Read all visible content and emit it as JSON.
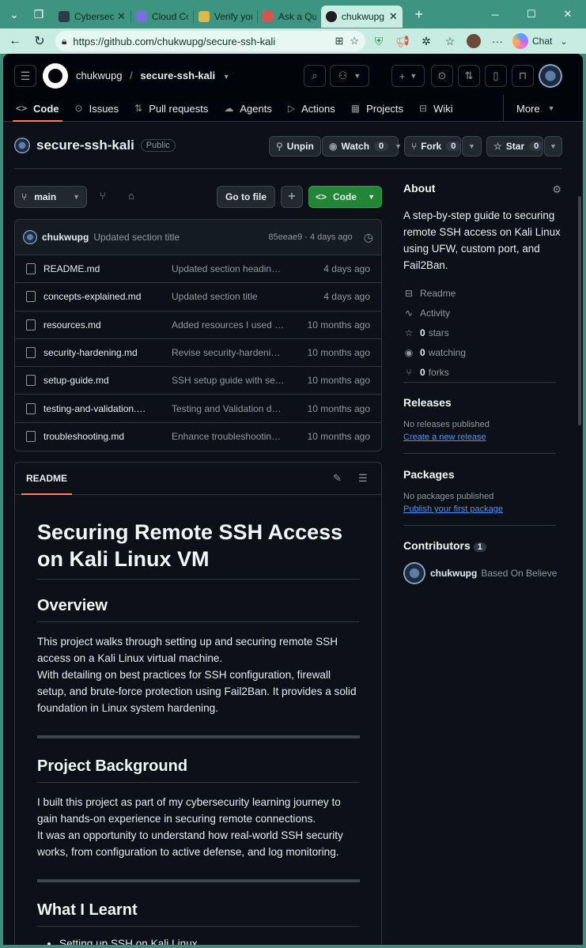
{
  "browser": {
    "tabs": [
      {
        "title": "Cybersecu",
        "favicon": "#2d3a48"
      },
      {
        "title": "Cloud Cor",
        "favicon": "#7d6ee0"
      },
      {
        "title": "Verify you",
        "favicon": "#e0b84a"
      },
      {
        "title": "Ask a Que",
        "favicon": "#d9534f"
      },
      {
        "title": "chukwupg",
        "favicon": "#1b1f24"
      }
    ],
    "url": "https://github.com/chukwupg/secure-ssh-kali",
    "chat_label": "Chat"
  },
  "header": {
    "owner": "chukwupg",
    "repo": "secure-ssh-kali"
  },
  "repo_nav": [
    {
      "label": "Code",
      "icon": "code-icon"
    },
    {
      "label": "Issues",
      "icon": "issue-icon"
    },
    {
      "label": "Pull requests",
      "icon": "pull-request-icon"
    },
    {
      "label": "Agents",
      "icon": "agents-icon"
    },
    {
      "label": "Actions",
      "icon": "play-icon"
    },
    {
      "label": "Projects",
      "icon": "table-icon"
    },
    {
      "label": "Wiki",
      "icon": "book-icon"
    }
  ],
  "more_label": "More",
  "repo": {
    "name": "secure-ssh-kali",
    "visibility": "Public",
    "unpin": "Unpin",
    "watch": "Watch",
    "watch_count": "0",
    "fork": "Fork",
    "fork_count": "0",
    "star": "Star",
    "star_count": "0"
  },
  "toolbar": {
    "branch": "main",
    "go_to_file": "Go to file",
    "code": "Code"
  },
  "commit": {
    "author": "chukwupg",
    "message": "Updated section title",
    "meta": "85eeae9 · 4 days ago"
  },
  "files": [
    {
      "name": "README.md",
      "message": "Updated section heading…",
      "time": "4 days ago"
    },
    {
      "name": "concepts-explained.md",
      "message": "Updated section title",
      "time": "4 days ago"
    },
    {
      "name": "resources.md",
      "message": "Added resources I used f…",
      "time": "10 months ago"
    },
    {
      "name": "security-hardening.md",
      "message": "Revise security-hardening…",
      "time": "10 months ago"
    },
    {
      "name": "setup-guide.md",
      "message": "SSH setup guide with sec…",
      "time": "10 months ago"
    },
    {
      "name": "testing-and-validation.…",
      "message": "Testing and Validation do…",
      "time": "10 months ago"
    },
    {
      "name": "troubleshooting.md",
      "message": "Enhance troubleshooting …",
      "time": "10 months ago"
    }
  ],
  "readme": {
    "tab": "README",
    "h1": "Securing Remote SSH Access on Kali Linux VM",
    "overview_h": "Overview",
    "overview_p1": "This project walks through setting up and securing remote SSH access on a Kali Linux virtual machine.",
    "overview_p2": "With detailing on best practices for SSH configuration, firewall setup, and brute-force protection using Fail2Ban. It provides a solid foundation in Linux system hardening.",
    "background_h": "Project Background",
    "background_p1": "I built this project as part of my cybersecurity learning journey to gain hands-on experience in securing remote connections.",
    "background_p2": "It was an opportunity to understand how real-world SSH security works, from configuration to active defense, and log monitoring.",
    "learnt_h": "What I Learnt",
    "learnt_items": [
      "Setting up SSH on Kali Linux"
    ]
  },
  "about": {
    "title": "About",
    "description": "A step-by-step guide to securing remote SSH access on Kali Linux using UFW, custom port, and Fail2Ban.",
    "readme": "Readme",
    "activity": "Activity",
    "stars": "0",
    "stars_label": "stars",
    "watching": "0",
    "watching_label": "watching",
    "forks": "0",
    "forks_label": "forks"
  },
  "releases": {
    "title": "Releases",
    "none": "No releases published",
    "link": "Create a new release"
  },
  "packages": {
    "title": "Packages",
    "none": "No packages published",
    "link": "Publish your first package"
  },
  "contributors": {
    "title": "Contributors",
    "count": "1",
    "name": "chukwupg",
    "subtitle": "Based On Believe"
  }
}
